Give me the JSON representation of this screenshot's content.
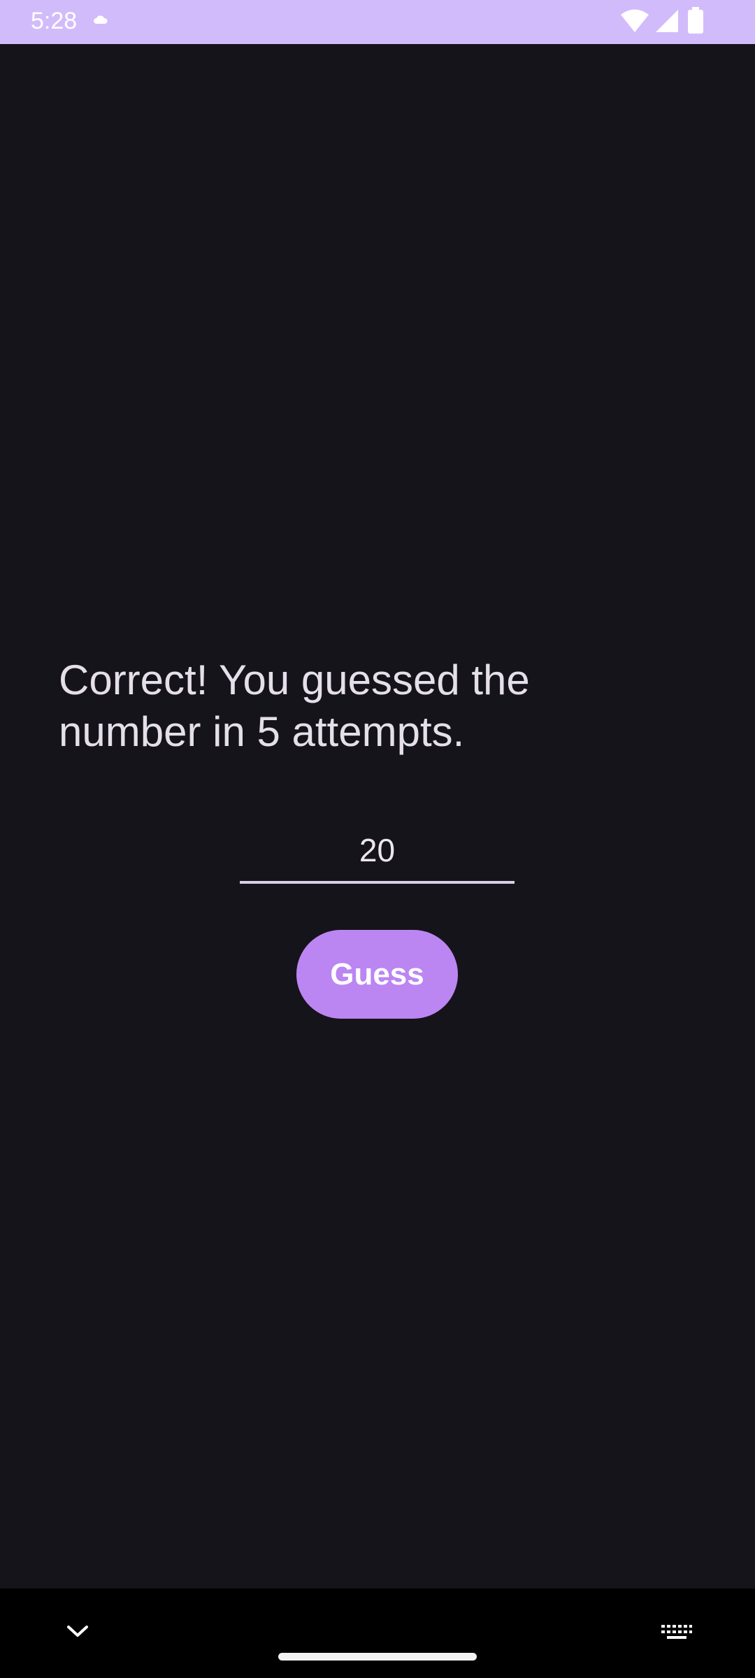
{
  "status_bar": {
    "time": "5:28",
    "background_color": "#d2bbfb",
    "icons": [
      "cloud-icon",
      "wifi-icon",
      "cell-signal-icon",
      "battery-icon"
    ]
  },
  "game": {
    "result_message": "Correct! You guessed the number in 5 attempts.",
    "guess_input_value": "20",
    "guess_button_label": "Guess",
    "accent_color": "#bb86f2",
    "background_color": "#16141b"
  },
  "navigation_bar": {
    "icons": [
      "chevron-down-icon",
      "home-handle",
      "keyboard-icon"
    ]
  }
}
